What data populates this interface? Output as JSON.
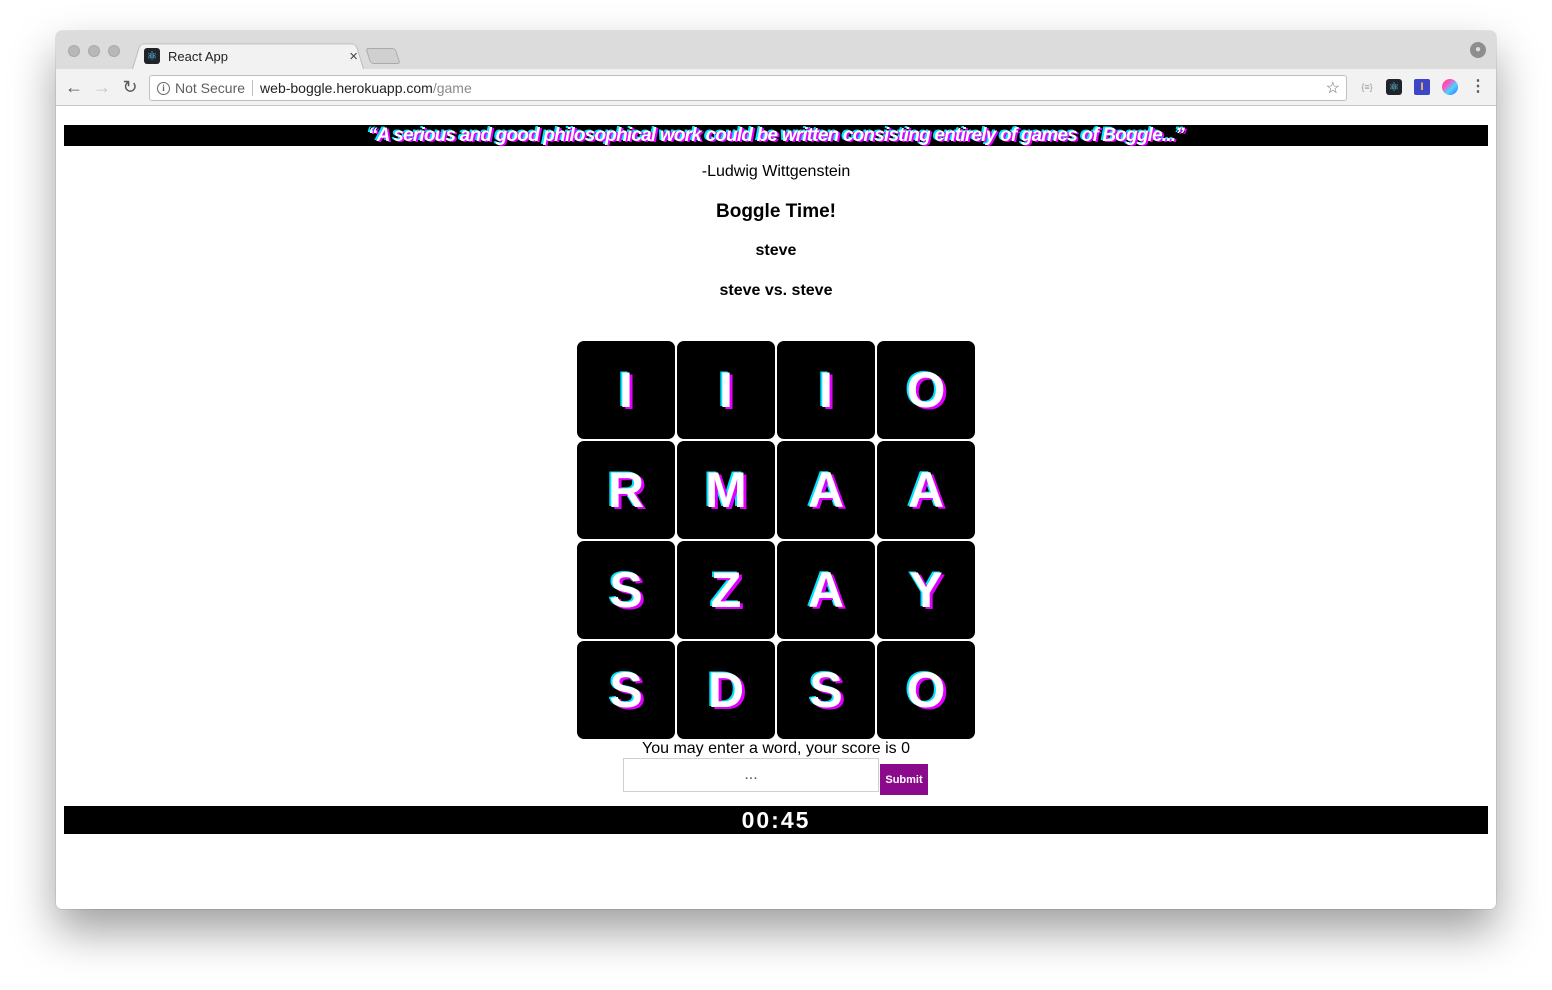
{
  "browser": {
    "tab_title": "React App",
    "tab_close": "×",
    "security_label": "Not Secure",
    "url_host": "web-boggle.herokuapp.com",
    "url_path": "/game",
    "back": "←",
    "forward": "→",
    "reload": "↻",
    "info": "i",
    "star": "☆",
    "ext_json": "{≡}",
    "ext_react": "⚛",
    "ext_bar": "I",
    "menu": "⋮",
    "profile": "●"
  },
  "page": {
    "quote": "“A serious and good philosophical work could be written consisting entirely of games of Boggle...”",
    "author": "-Ludwig Wittgenstein",
    "title": "Boggle Time!",
    "player": "steve",
    "matchup": "steve vs. steve",
    "board": [
      [
        "I",
        "I",
        "I",
        "O"
      ],
      [
        "R",
        "M",
        "A",
        "A"
      ],
      [
        "S",
        "Z",
        "A",
        "Y"
      ],
      [
        "S",
        "D",
        "S",
        "O"
      ]
    ],
    "status": "You may enter a word, your score is 0",
    "input_placeholder": "...",
    "submit_label": "Submit",
    "timer": "00:45"
  },
  "colors": {
    "submit_bg": "#8b0a8b",
    "bar_bg": "#000000",
    "glitch_magenta": "#e000ff",
    "glitch_cyan": "#00e5ff"
  }
}
